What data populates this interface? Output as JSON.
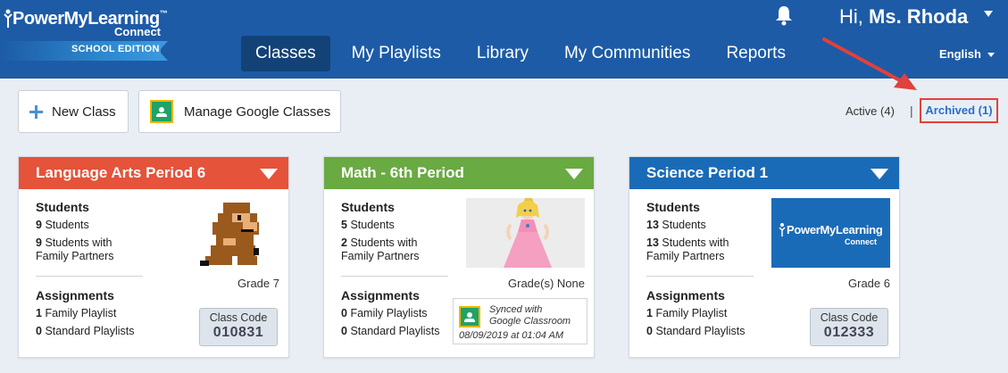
{
  "brand": {
    "name": "PowerMyLearning",
    "connect": "Connect",
    "edition": "SCHOOL EDITION"
  },
  "nav": [
    "Classes",
    "My Playlists",
    "Library",
    "My Communities",
    "Reports"
  ],
  "user": {
    "greeting": "Hi,",
    "name": "Ms. Rhoda"
  },
  "language": "English",
  "toolbar": {
    "new_class": "New Class",
    "manage_google": "Manage Google Classes",
    "active": "Active (4)",
    "separator": "|",
    "archived": "Archived (1)"
  },
  "colors": {
    "header": "#1d5ba6",
    "card_language_arts": "#e4533a",
    "card_math": "#6aaa42",
    "card_science": "#1a6bb7",
    "highlight": "#e0413c"
  },
  "cards": [
    {
      "title": "Language Arts Period 6",
      "students_heading": "Students",
      "students_count": "9",
      "students_label": "Students",
      "family_count": "9",
      "family_label_1": "Students with",
      "family_label_2": "Family Partners",
      "grade": "Grade 7",
      "assignments_heading": "Assignments",
      "family_playlists_count": "1",
      "family_playlists_label": "Family Playlist",
      "standard_playlists_count": "0",
      "standard_playlists_label": "Standard Playlists",
      "code_label": "Class Code",
      "code": "010831",
      "image": "mario-sprite"
    },
    {
      "title": "Math - 6th Period",
      "students_heading": "Students",
      "students_count": "5",
      "students_label": "Students",
      "family_count": "2",
      "family_label_1": "Students with",
      "family_label_2": "Family Partners",
      "grade": "Grade(s) None",
      "assignments_heading": "Assignments",
      "family_playlists_count": "0",
      "family_playlists_label": "Family Playlists",
      "standard_playlists_count": "0",
      "standard_playlists_label": "Standard Playlists",
      "synced_line_1": "Synced with",
      "synced_line_2": "Google Classroom",
      "synced_date": "08/09/2019 at 01:04 AM",
      "image": "princess-character"
    },
    {
      "title": "Science Period 1",
      "students_heading": "Students",
      "students_count": "13",
      "students_label": "Students",
      "family_count": "13",
      "family_label_1": "Students with",
      "family_label_2": "Family Partners",
      "grade": "Grade 6",
      "assignments_heading": "Assignments",
      "family_playlists_count": "1",
      "family_playlists_label": "Family Playlist",
      "standard_playlists_count": "0",
      "standard_playlists_label": "Standard Playlists",
      "code_label": "Class Code",
      "code": "012333",
      "image": "pml-logo",
      "image_brand": "PowerMyLearning",
      "image_connect": "Connect"
    }
  ]
}
